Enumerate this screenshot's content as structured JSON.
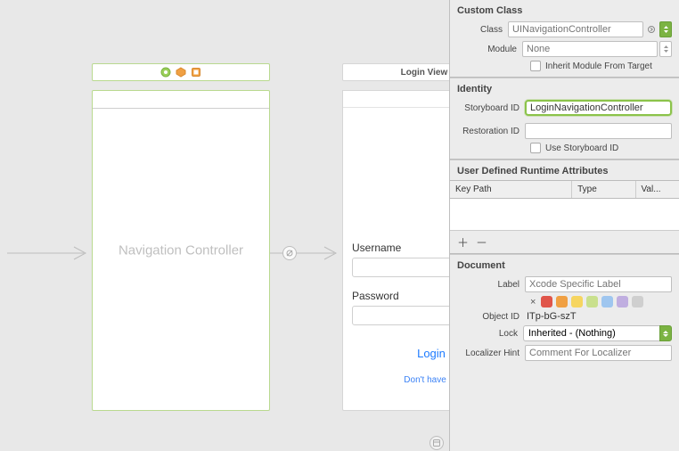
{
  "canvas": {
    "navController": {
      "title": "Navigation Controller"
    },
    "loginScene": {
      "topbarTitle": "Login View Co",
      "usernameLabel": "Username",
      "passwordLabel": "Password",
      "loginButton": "Login",
      "registerLink": "Don't have an"
    }
  },
  "inspector": {
    "customClass": {
      "header": "Custom Class",
      "classLabel": "Class",
      "classValue": "UINavigationController",
      "moduleLabel": "Module",
      "modulePlaceholder": "None",
      "inheritCheckbox": "Inherit Module From Target"
    },
    "identity": {
      "header": "Identity",
      "storyboardIdLabel": "Storyboard ID",
      "storyboardIdValue": "LoginNavigationController",
      "restorationIdLabel": "Restoration ID",
      "useStoryboardIdCheckbox": "Use Storyboard ID"
    },
    "runtime": {
      "header": "User Defined Runtime Attributes",
      "col1": "Key Path",
      "col2": "Type",
      "col3": "Val...",
      "plus": "＋",
      "minus": "－"
    },
    "document": {
      "header": "Document",
      "labelLabel": "Label",
      "labelPlaceholder": "Xcode Specific Label",
      "swatches": [
        "#e0554a",
        "#f0a043",
        "#f6d560",
        "#c9e08d",
        "#9fc6ef",
        "#c0aee0",
        "#cfcfcf"
      ],
      "objectIdLabel": "Object ID",
      "objectIdValue": "ITp-bG-szT",
      "lockLabel": "Lock",
      "lockValue": "Inherited - (Nothing)",
      "hintLabel": "Localizer Hint",
      "hintPlaceholder": "Comment For Localizer"
    }
  }
}
